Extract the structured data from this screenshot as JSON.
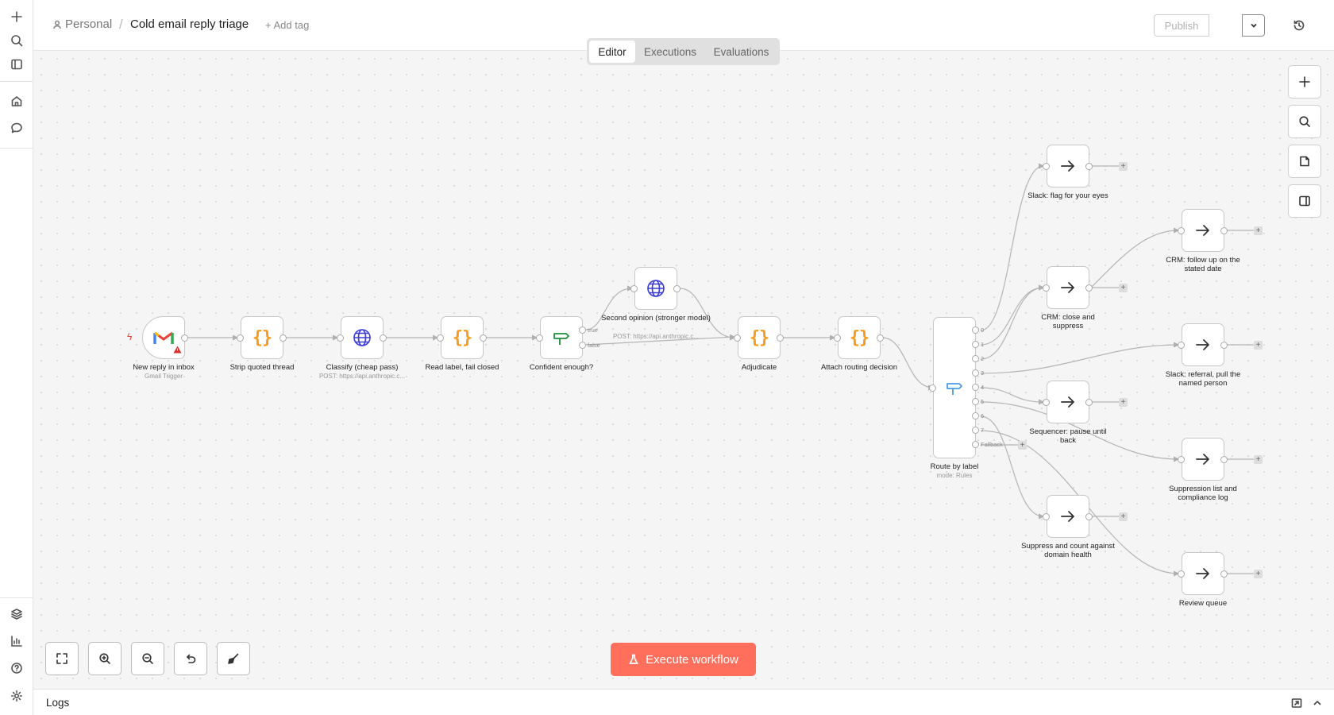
{
  "header": {
    "project": "Personal",
    "separator": "/",
    "workflow_name": "Cold email reply triage",
    "add_tag": "+ Add tag",
    "publish_label": "Publish"
  },
  "tabs": [
    {
      "label": "Editor",
      "active": true
    },
    {
      "label": "Executions",
      "active": false
    },
    {
      "label": "Evaluations",
      "active": false
    }
  ],
  "nodes": {
    "trigger": {
      "label": "New reply in inbox",
      "sub": "Gmail Trigger",
      "icon": "gmail-icon"
    },
    "strip": {
      "label": "Strip quoted thread",
      "icon": "code-braces-icon"
    },
    "classify": {
      "label": "Classify (cheap pass)",
      "sub": "POST: https://api.anthropic.c...",
      "icon": "globe-icon"
    },
    "read_label": {
      "label": "Read label, fail closed",
      "icon": "code-braces-icon"
    },
    "confident": {
      "label": "Confident enough?",
      "icon": "signpost-icon",
      "true_label": "true",
      "false_label": "false"
    },
    "second": {
      "label": "Second opinion (stronger model)",
      "sub": "POST: https://api.anthropic.c...",
      "icon": "globe-icon"
    },
    "adjudicate": {
      "label": "Adjudicate",
      "icon": "code-braces-icon"
    },
    "attach": {
      "label": "Attach routing decision",
      "icon": "code-braces-icon"
    },
    "route": {
      "label": "Route by label",
      "sub": "mode: Rules",
      "icon": "signpost-icon",
      "outputs": [
        "0",
        "1",
        "2",
        "3",
        "4",
        "5",
        "6",
        "7",
        "Fallback"
      ]
    },
    "slack_flag": {
      "label": "Slack: flag for your eyes",
      "icon": "arrow-right-icon"
    },
    "crm_close": {
      "label": "CRM: close and suppress",
      "icon": "arrow-right-icon"
    },
    "sequencer": {
      "label": "Sequencer: pause until back",
      "icon": "arrow-right-icon"
    },
    "suppress_count": {
      "label": "Suppress and count against domain health",
      "icon": "arrow-right-icon"
    },
    "crm_follow": {
      "label": "CRM: follow up on the stated date",
      "icon": "arrow-right-icon"
    },
    "slack_referral": {
      "label": "Slack: referral, pull the named person",
      "icon": "arrow-right-icon"
    },
    "suppression_list": {
      "label": "Suppression list and compliance log",
      "icon": "arrow-right-icon"
    },
    "review_queue": {
      "label": "Review queue",
      "icon": "arrow-right-icon"
    }
  },
  "execute_label": "Execute workflow",
  "logs_title": "Logs",
  "colors": {
    "accent": "#ff6f5c",
    "code": "#f59b22",
    "globe": "#3b3bd6",
    "if": "#1f8f3a",
    "switch": "#4a9be8"
  }
}
